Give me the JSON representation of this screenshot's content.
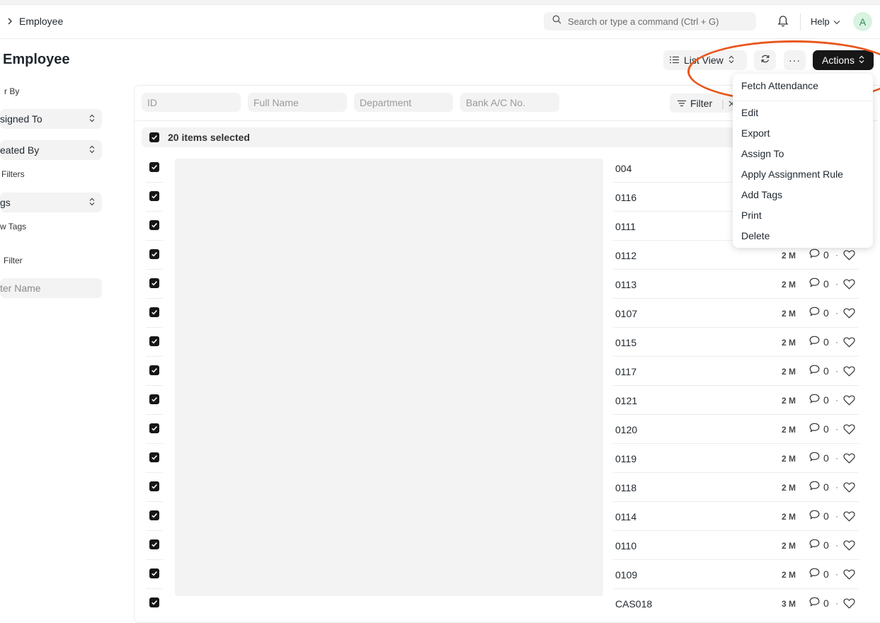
{
  "breadcrumb": {
    "current": "Employee"
  },
  "search": {
    "placeholder": "Search or type a command (Ctrl + G)"
  },
  "navbar": {
    "help_label": "Help",
    "avatar_initial": "A"
  },
  "page": {
    "title": "Employee"
  },
  "toolbar": {
    "list_view_label": "List View",
    "more_label": "···",
    "actions_label": "Actions"
  },
  "sidebar": {
    "filter_by_label": "r By",
    "assigned_to_label": "signed To",
    "created_by_label": "eated By",
    "edit_filters_label": "Filters",
    "tags_label": "gs",
    "show_tags_label": "w Tags",
    "save_filter_label": "Filter",
    "filter_name_placeholder": "ter Name"
  },
  "filters": {
    "id_placeholder": "ID",
    "full_name_placeholder": "Full Name",
    "department_placeholder": "Department",
    "bank_placeholder": "Bank A/C No.",
    "filter_label": "Filter"
  },
  "selection": {
    "label": "20 items selected"
  },
  "rows": [
    {
      "id": "004",
      "time": "",
      "comments": ""
    },
    {
      "id": "0116",
      "time": "",
      "comments": ""
    },
    {
      "id": "0111",
      "time": "",
      "comments": ""
    },
    {
      "id": "0112",
      "time": "2 M",
      "comments": "0"
    },
    {
      "id": "0113",
      "time": "2 M",
      "comments": "0"
    },
    {
      "id": "0107",
      "time": "2 M",
      "comments": "0"
    },
    {
      "id": "0115",
      "time": "2 M",
      "comments": "0"
    },
    {
      "id": "0117",
      "time": "2 M",
      "comments": "0"
    },
    {
      "id": "0121",
      "time": "2 M",
      "comments": "0"
    },
    {
      "id": "0120",
      "time": "2 M",
      "comments": "0"
    },
    {
      "id": "0119",
      "time": "2 M",
      "comments": "0"
    },
    {
      "id": "0118",
      "time": "2 M",
      "comments": "0"
    },
    {
      "id": "0114",
      "time": "2 M",
      "comments": "0"
    },
    {
      "id": "0110",
      "time": "2 M",
      "comments": "0"
    },
    {
      "id": "0109",
      "time": "2 M",
      "comments": "0"
    },
    {
      "id": "CAS018",
      "time": "3 M",
      "comments": "0"
    }
  ],
  "actions_menu": {
    "items": [
      "Fetch Attendance",
      "Edit",
      "Export",
      "Assign To",
      "Apply Assignment Rule",
      "Add Tags",
      "Print",
      "Delete"
    ]
  },
  "colors": {
    "accent_highlight": "#e8571d",
    "primary_button": "#171717"
  }
}
